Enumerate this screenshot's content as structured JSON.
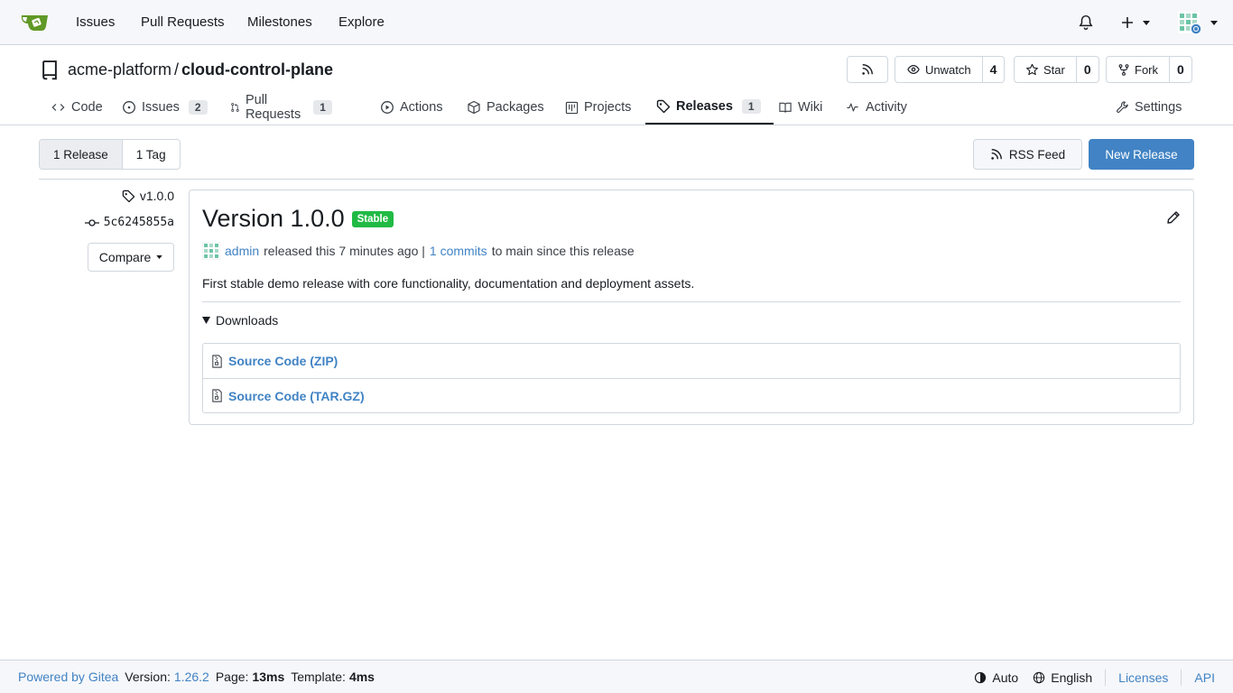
{
  "navbar": {
    "links": [
      "Issues",
      "Pull Requests",
      "Milestones",
      "Explore"
    ]
  },
  "repo": {
    "owner": "acme-platform",
    "separator": "/",
    "name": "cloud-control-plane",
    "watch": {
      "label": "Unwatch",
      "count": "4"
    },
    "star": {
      "label": "Star",
      "count": "0"
    },
    "fork": {
      "label": "Fork",
      "count": "0"
    }
  },
  "tabs": [
    {
      "label": "Code",
      "icon": "code-icon"
    },
    {
      "label": "Issues",
      "badge": "2",
      "icon": "issue-icon"
    },
    {
      "label": "Pull Requests",
      "badge": "1",
      "icon": "pull-request-icon"
    },
    {
      "label": "Actions",
      "icon": "play-icon"
    },
    {
      "label": "Packages",
      "icon": "package-icon"
    },
    {
      "label": "Projects",
      "icon": "project-icon"
    },
    {
      "label": "Releases",
      "badge": "1",
      "icon": "tag-icon",
      "active": true
    },
    {
      "label": "Wiki",
      "icon": "book-icon"
    },
    {
      "label": "Activity",
      "icon": "pulse-icon"
    },
    {
      "label": "Settings",
      "icon": "tools-icon"
    }
  ],
  "releases_page": {
    "release_count": "1 Release",
    "tag_count": "1 Tag",
    "rss_label": "RSS Feed",
    "new_release_label": "New Release"
  },
  "release": {
    "tag": "v1.0.0",
    "commit": "5c6245855a",
    "compare_label": "Compare",
    "title": "Version 1.0.0",
    "badge": "Stable",
    "author": "admin",
    "released_text": "released this 7 minutes ago |",
    "commits_link": "1 commits",
    "commits_suffix": "to main since this release",
    "description": "First stable demo release with core functionality, documentation and deployment assets.",
    "downloads_label": "Downloads",
    "downloads": [
      "Source Code (ZIP)",
      "Source Code (TAR.GZ)"
    ]
  },
  "footer": {
    "powered_by": "Powered by Gitea",
    "version_label": "Version:",
    "version": "1.26.2",
    "page_label": "Page:",
    "page_time": "13ms",
    "template_label": "Template:",
    "template_time": "4ms",
    "theme": "Auto",
    "language": "English",
    "licenses": "Licenses",
    "api": "API"
  },
  "colors": {
    "accent": "#4183c4",
    "stable": "#21ba45",
    "logo": "#609926"
  }
}
